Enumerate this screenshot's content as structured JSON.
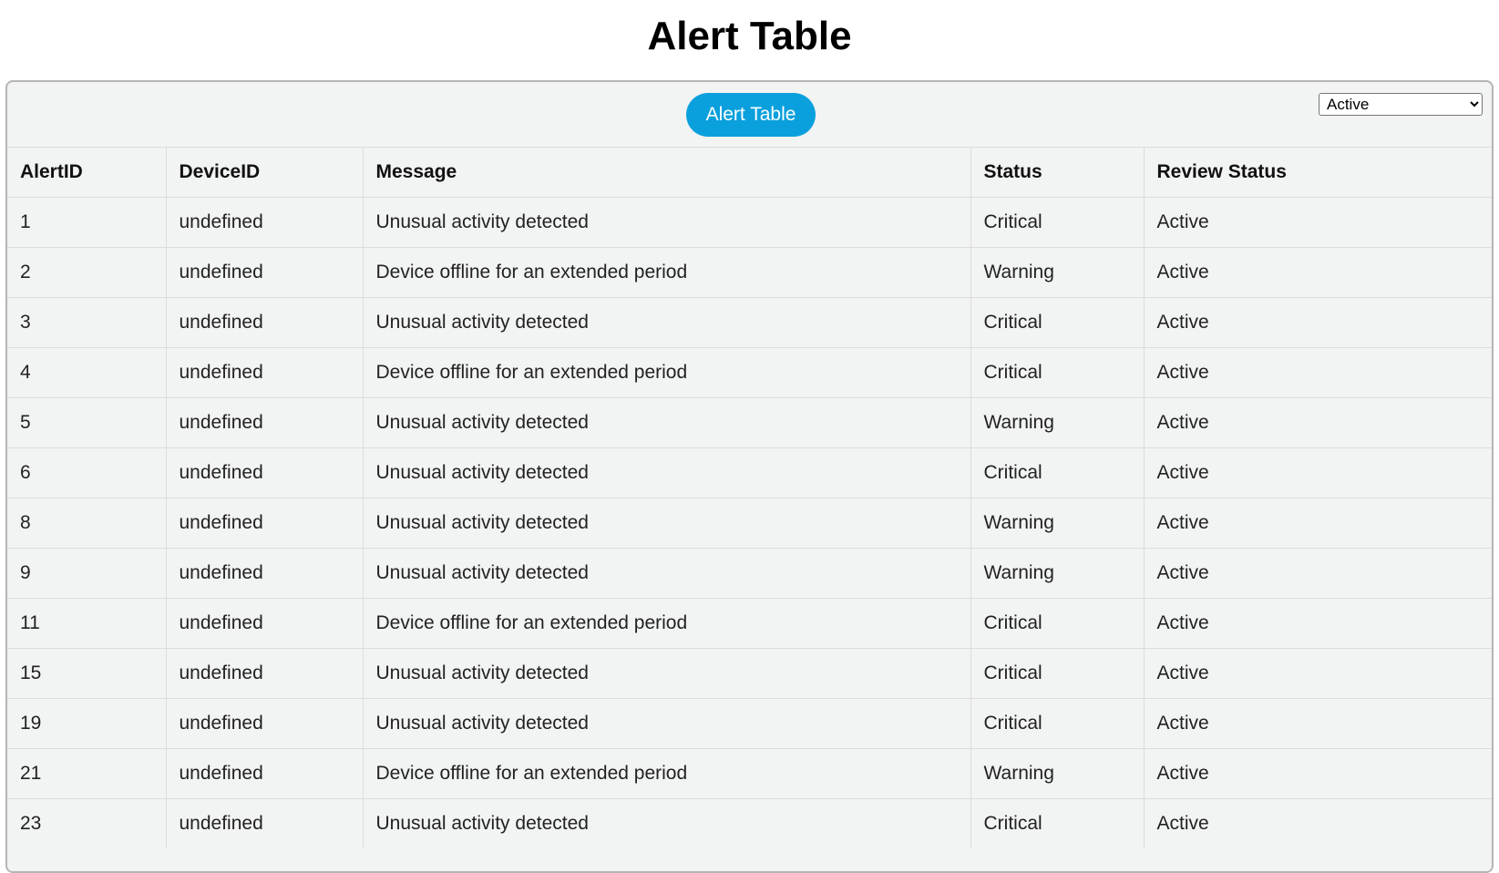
{
  "page": {
    "title": "Alert Table"
  },
  "toolbar": {
    "button_label": "Alert Table",
    "filter": {
      "selected": "Active",
      "options": [
        "Active"
      ]
    },
    "button_color": "#0aa0dd"
  },
  "table": {
    "columns": [
      "AlertID",
      "DeviceID",
      "Message",
      "Status",
      "Review Status"
    ],
    "rows": [
      [
        "1",
        "undefined",
        "Unusual activity detected",
        "Critical",
        "Active"
      ],
      [
        "2",
        "undefined",
        "Device offline for an extended period",
        "Warning",
        "Active"
      ],
      [
        "3",
        "undefined",
        "Unusual activity detected",
        "Critical",
        "Active"
      ],
      [
        "4",
        "undefined",
        "Device offline for an extended period",
        "Critical",
        "Active"
      ],
      [
        "5",
        "undefined",
        "Unusual activity detected",
        "Warning",
        "Active"
      ],
      [
        "6",
        "undefined",
        "Unusual activity detected",
        "Critical",
        "Active"
      ],
      [
        "8",
        "undefined",
        "Unusual activity detected",
        "Warning",
        "Active"
      ],
      [
        "9",
        "undefined",
        "Unusual activity detected",
        "Warning",
        "Active"
      ],
      [
        "11",
        "undefined",
        "Device offline for an extended period",
        "Critical",
        "Active"
      ],
      [
        "15",
        "undefined",
        "Unusual activity detected",
        "Critical",
        "Active"
      ],
      [
        "19",
        "undefined",
        "Unusual activity detected",
        "Critical",
        "Active"
      ],
      [
        "21",
        "undefined",
        "Device offline for an extended period",
        "Warning",
        "Active"
      ],
      [
        "23",
        "undefined",
        "Unusual activity detected",
        "Critical",
        "Active"
      ]
    ]
  }
}
